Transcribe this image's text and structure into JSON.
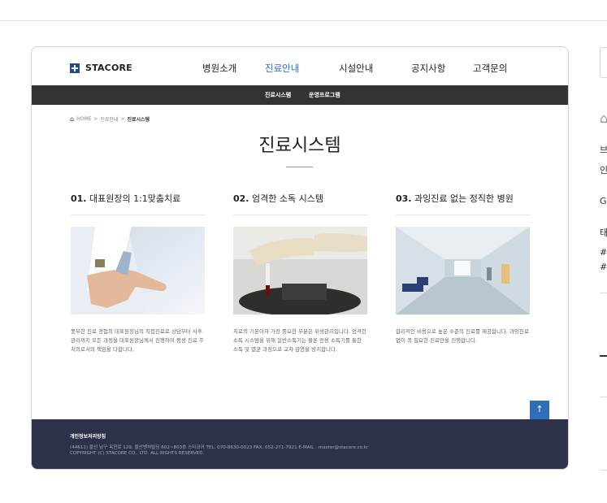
{
  "right_column": {
    "t1": "브",
    "t2": "인",
    "t3": "G",
    "t4": "태",
    "t5": "#",
    "t6": "#"
  },
  "logo": {
    "text": "STACORE"
  },
  "gnb": [
    {
      "label": "병원소개"
    },
    {
      "label": "진료안내",
      "active": true
    },
    {
      "label": "시설안내"
    },
    {
      "label": "공지사항"
    },
    {
      "label": "고객문의"
    }
  ],
  "subnav": [
    {
      "label": "진료시스템"
    },
    {
      "label": "운영프로그램"
    }
  ],
  "breadcrumb": {
    "home": "HOME",
    "sep1": ">",
    "level1": "진료안내",
    "sep2": ">",
    "current": "진료시스템"
  },
  "page_title": "진료시스템",
  "columns": [
    {
      "num": "01.",
      "title": "대표원장의 1:1맞춤치료",
      "text": "풍부한 진료 경험의 대표원장님의 직접진료로 상담부터 사후관리까지 모든 과정을 대표원장님께서 진행하여 평생 진료 주치의로서의 책임을 다합니다."
    },
    {
      "num": "02.",
      "title": "엄격한 소독 시스템",
      "text": "치료의 기본이자 가장 중요한 부분은 위생관리입니다. 엄격한 소독 시스템을 위해 일반소독기는 물론 전용 소독기를 통한 소독 및 멸균 과정으로 교차 감염을 방지합니다."
    },
    {
      "num": "03.",
      "title": "과잉진료 없는 정직한 병원",
      "text": "합리적인 비용으로 높은 수준의 진료를 제공합니다. 과잉진료 없이 꼭 필요한 진료만을 진행합니다."
    }
  ],
  "top_button": {
    "label": "↑"
  },
  "footer": {
    "title": "개인정보처리방침",
    "address": "(44611) 울산 남구 옥현로 129, 울산벤처빌딩 802~803호 스타코어 TEL. 070-8630-0023 FAX. 052-271-7921 E-MAIL : master@stacore.co.kr",
    "copyright": "COPYRIGHT (C) STACORE CO., LTD. ALL RIGHTS RESERVED."
  },
  "colors": {
    "accent": "#2b6cc4",
    "subnav_bg": "#333333",
    "footer_bg": "#2d3149",
    "top_button": "#2f6fb7"
  }
}
